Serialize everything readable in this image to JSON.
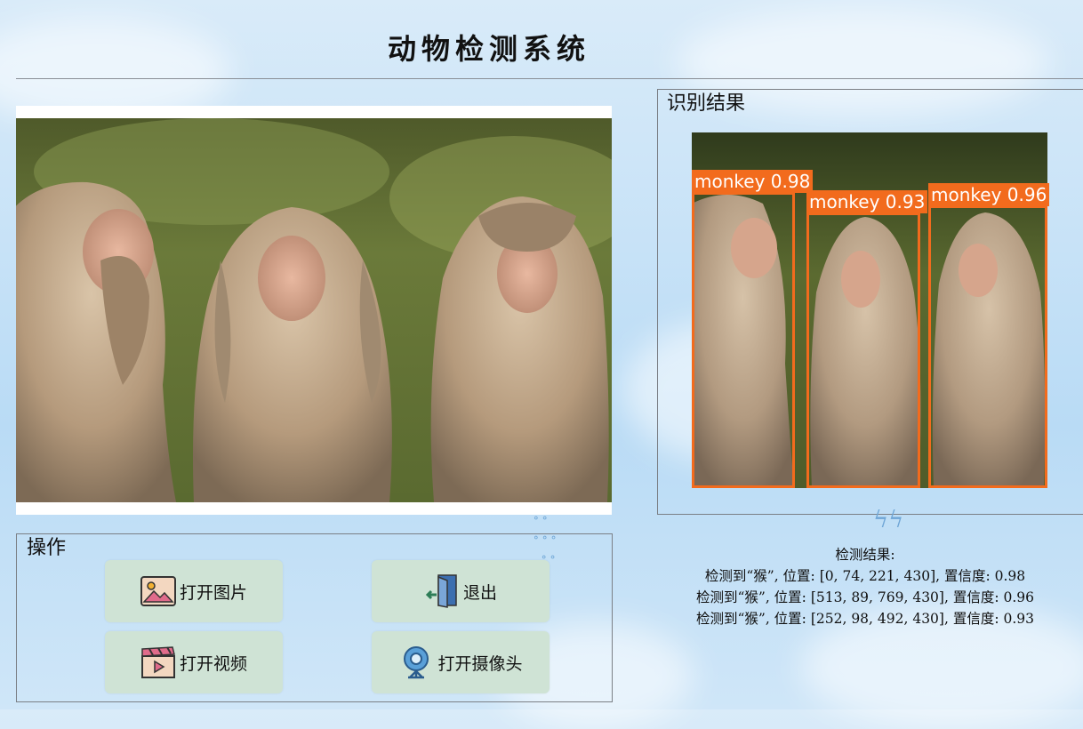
{
  "window": {
    "title": "动物检测系统"
  },
  "result_panel": {
    "title": "识别结果"
  },
  "detections": [
    {
      "label": "monkey 0.98"
    },
    {
      "label": "monkey 0.93"
    },
    {
      "label": "monkey 0.96"
    }
  ],
  "operations": {
    "title": "操作",
    "open_image": "打开图片",
    "exit": "退出",
    "open_video": "打开视频",
    "open_camera": "打开摄像头"
  },
  "detect_text": {
    "header": "检测结果:",
    "lines": [
      "检测到“猴”, 位置: [0, 74, 221, 430], 置信度: 0.98",
      "检测到“猴”, 位置: [513, 89, 769, 430], 置信度: 0.96",
      "检测到“猴”, 位置: [252, 98, 492, 430], 置信度: 0.93"
    ]
  },
  "colors": {
    "bbox": "#f26b1d",
    "button_bg": "#cfe3d5"
  },
  "icons": [
    "image-icon",
    "exit-door-icon",
    "video-clapper-icon",
    "webcam-icon"
  ]
}
